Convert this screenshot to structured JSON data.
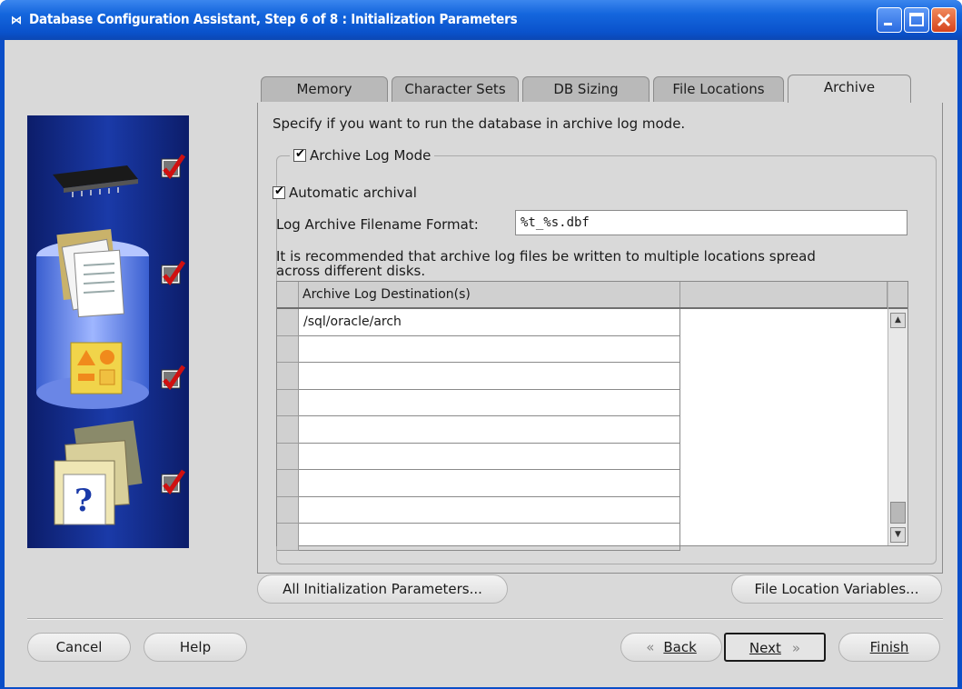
{
  "window": {
    "title": "Database Configuration Assistant, Step 6 of 8 : Initialization Parameters",
    "icon": "oracle-dbca-icon",
    "controls": [
      "minimize",
      "maximize",
      "close"
    ]
  },
  "side_panel": {
    "steps": [
      {
        "icon": "memory-chip-icon",
        "checked": true
      },
      {
        "icon": "documents-database-icon",
        "checked": true
      },
      {
        "icon": "shapes-database-icon",
        "checked": true
      },
      {
        "icon": "help-folders-icon",
        "checked": true
      }
    ]
  },
  "tabs": [
    {
      "label": "Memory",
      "active": false
    },
    {
      "label": "Character Sets",
      "active": false
    },
    {
      "label": "DB Sizing",
      "active": false
    },
    {
      "label": "File Locations",
      "active": false
    },
    {
      "label": "Archive",
      "active": true
    }
  ],
  "archive": {
    "description": "Specify if you want to run the database in archive log mode.",
    "archive_log_mode_label": "Archive Log Mode",
    "archive_log_mode_checked": true,
    "automatic_archival_label": "Automatic archival",
    "automatic_archival_checked": true,
    "format_label": "Log Archive Filename Format:",
    "format_value": "%t_%s.dbf",
    "recommendation_line1": "It is recommended that archive log files be written to multiple locations spread",
    "recommendation_line2": "across different disks.",
    "table": {
      "column_header": "Archive Log Destination(s)",
      "rows": [
        "/sql/oracle/arch",
        "",
        "",
        "",
        "",
        "",
        "",
        "",
        ""
      ]
    }
  },
  "buttons": {
    "all_init_params": "All Initialization Parameters...",
    "file_location_vars": "File Location Variables...",
    "cancel": "Cancel",
    "help": "Help",
    "back": "Back",
    "next": "Next",
    "finish": "Finish"
  }
}
